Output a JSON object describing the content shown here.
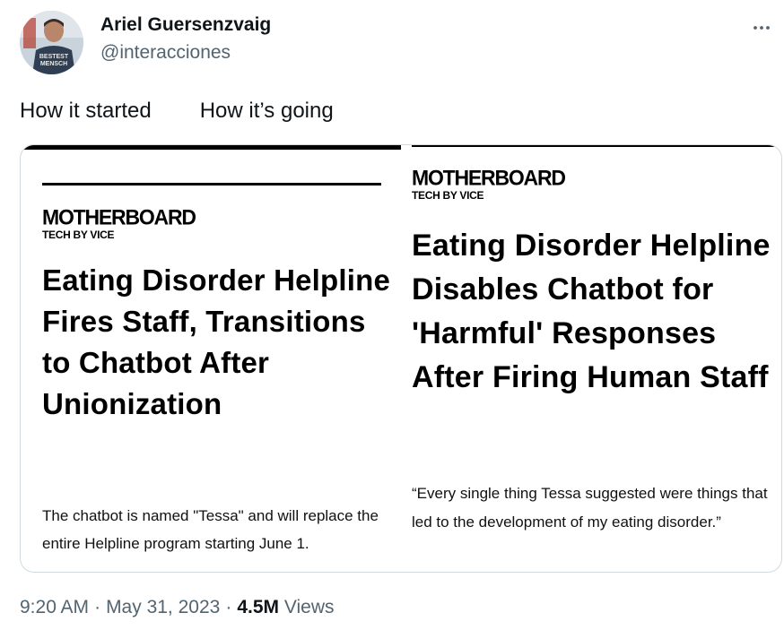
{
  "author": {
    "name": "Ariel Guersenzvaig",
    "handle": "@interacciones",
    "avatar_shirt_text_1": "BESTEST",
    "avatar_shirt_text_2": "MENSCH"
  },
  "tweet": {
    "text_left": "How it started",
    "text_right": "How it’s going"
  },
  "media": {
    "left": {
      "logo": "MOTHERBOARD",
      "sub": "TECH BY VICE",
      "headline": "Eating Disorder Helpline Fires Staff, Transitions to Chatbot After Unionization",
      "dek": "The chatbot is named \"Tessa\" and will replace the entire Helpline program starting June 1."
    },
    "right": {
      "logo": "MOTHERBOARD",
      "sub": "TECH BY VICE",
      "headline": "Eating Disorder Helpline Disables Chatbot for 'Harmful' Responses After Firing Human Staff",
      "dek": "“Every single thing Tessa suggested were things that led to the development of my eating disorder.”"
    }
  },
  "meta": {
    "time": "9:20 AM",
    "date": "May 31, 2023",
    "views_count": "4.5M",
    "views_label": "Views",
    "separator": "·"
  },
  "icons": {
    "more": "more-horizontal-icon"
  }
}
